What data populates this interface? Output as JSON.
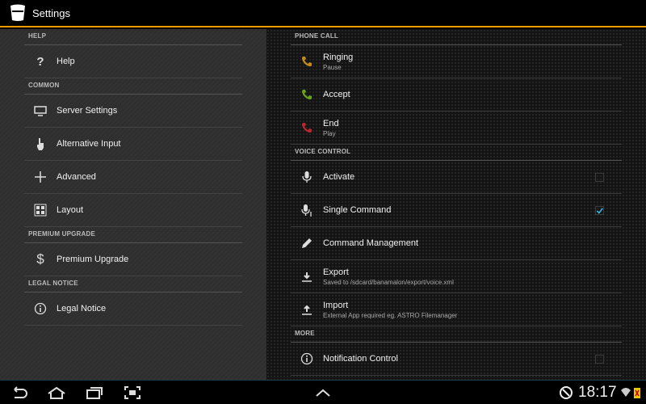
{
  "app": {
    "title": "Settings"
  },
  "left": {
    "sections": [
      {
        "header": "HELP",
        "items": [
          {
            "label": "Help",
            "icon": "question-icon"
          }
        ]
      },
      {
        "header": "COMMON",
        "items": [
          {
            "label": "Server Settings",
            "icon": "monitor-icon"
          },
          {
            "label": "Alternative Input",
            "icon": "hand-pointer-icon"
          },
          {
            "label": "Advanced",
            "icon": "plus-icon"
          },
          {
            "label": "Layout",
            "icon": "grid-icon"
          }
        ]
      },
      {
        "header": "PREMIUM UPGRADE",
        "items": [
          {
            "label": "Premium Upgrade",
            "icon": "dollar-icon"
          }
        ]
      },
      {
        "header": "LEGAL NOTICE",
        "items": [
          {
            "label": "Legal Notice",
            "icon": "info-icon"
          }
        ]
      }
    ]
  },
  "right": {
    "sections": [
      {
        "header": "PHONE CALL",
        "items": [
          {
            "label": "Ringing",
            "sub": "Pause",
            "icon": "phone-icon",
            "color": "#c58a1e"
          },
          {
            "label": "Accept",
            "icon": "phone-icon",
            "color": "#6aa21c"
          },
          {
            "label": "End",
            "sub": "Play",
            "icon": "phone-icon",
            "color": "#b8282c"
          }
        ]
      },
      {
        "header": "VOICE CONTROL",
        "items": [
          {
            "label": "Activate",
            "icon": "microphone-icon",
            "checked": false
          },
          {
            "label": "Single Command",
            "icon": "microphone-one-icon",
            "checked": true
          },
          {
            "label": "Command Management",
            "icon": "pencil-icon"
          },
          {
            "label": "Export",
            "sub": "Saved to /sdcard/banamalon/export/voice.xml",
            "icon": "download-icon"
          },
          {
            "label": "Import",
            "sub": "External App required eg. ASTRO Filemanager",
            "icon": "upload-icon"
          }
        ]
      },
      {
        "header": "MORE",
        "items": [
          {
            "label": "Notification Control",
            "icon": "info-icon",
            "checked": false
          }
        ]
      }
    ]
  },
  "status": {
    "time": "18:17"
  },
  "colors": {
    "accent": "#f39c00",
    "check": "#33b5e5"
  }
}
